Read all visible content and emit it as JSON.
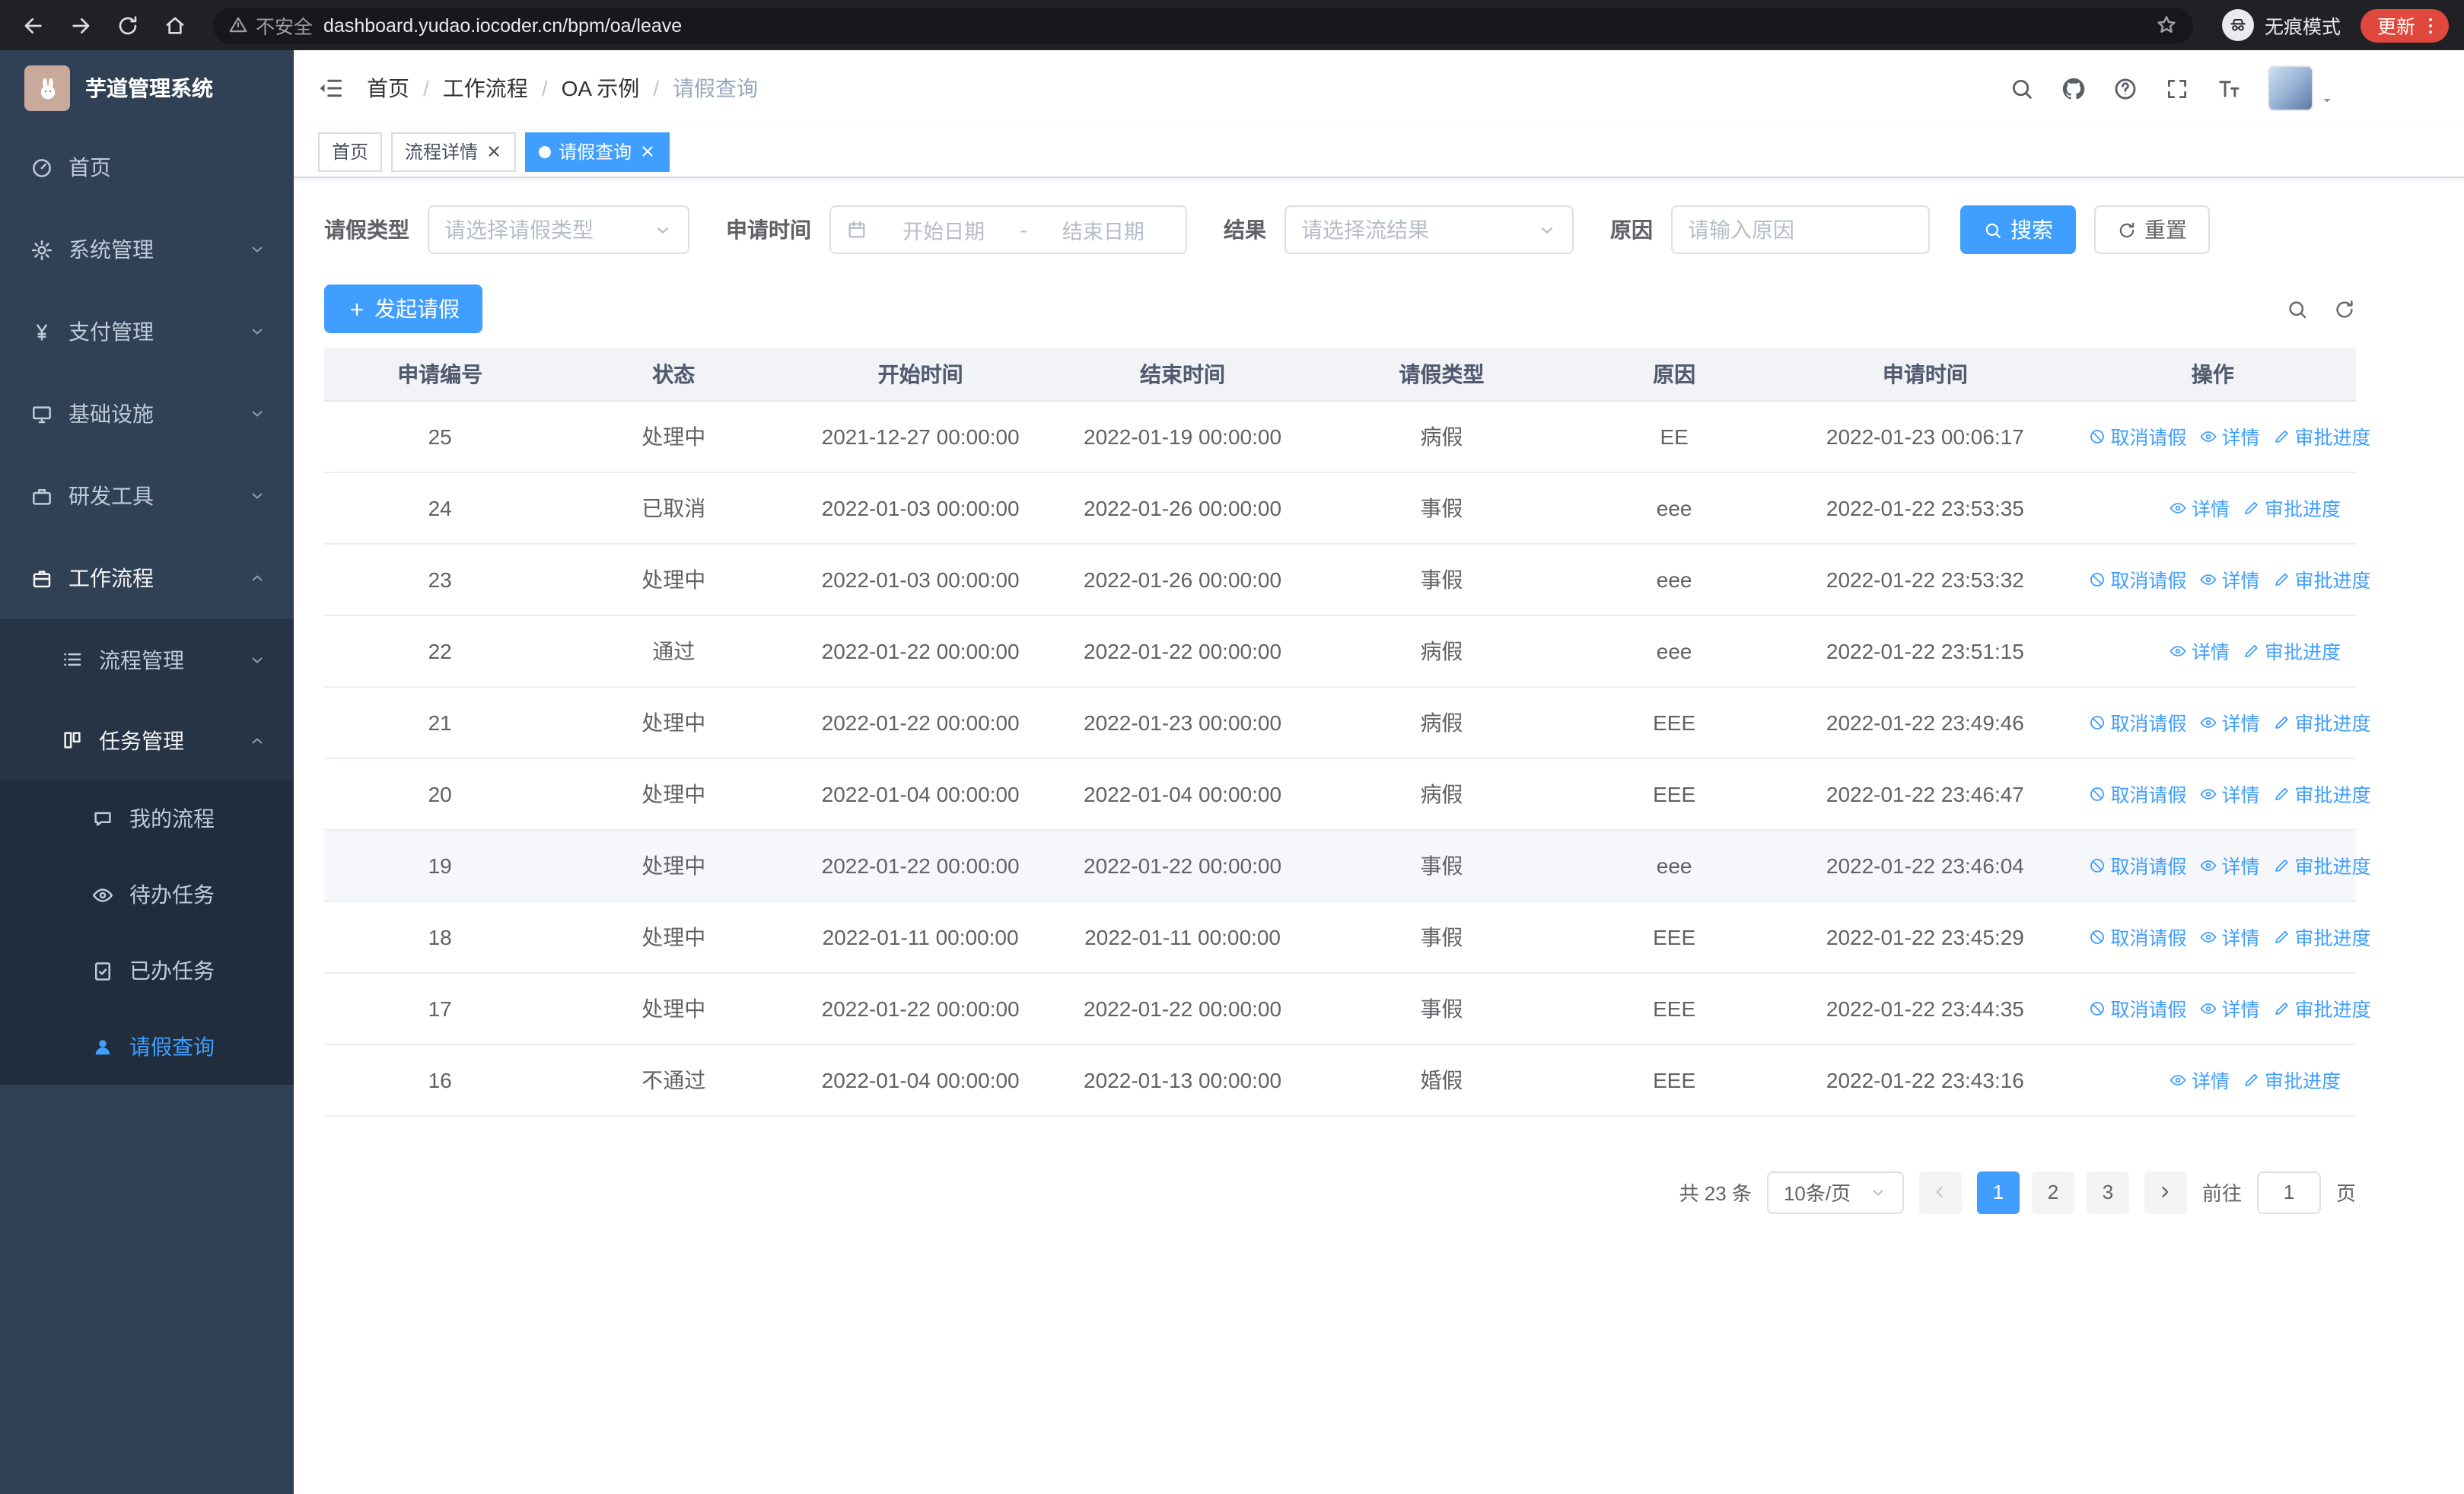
{
  "browser": {
    "nav_icons": [
      "back",
      "forward",
      "reload",
      "home"
    ],
    "security_chip": "不安全",
    "url": "dashboard.yudao.iocoder.cn/bpm/oa/leave",
    "incognito_label": "无痕模式",
    "update_button": "更新"
  },
  "colors": {
    "primary": "#409eff",
    "sidebar_bg": "#304156",
    "update_pill": "#e0483d"
  },
  "sidebar": {
    "title": "芋道管理系统",
    "menu": [
      {
        "key": "home",
        "label": "首页",
        "icon": "i-gauge",
        "level": 1
      },
      {
        "key": "system-management",
        "label": "系统管理",
        "icon": "i-gear",
        "level": 1,
        "chevron": "down"
      },
      {
        "key": "payment-management",
        "label": "支付管理",
        "icon": "i-yen",
        "level": 1,
        "chevron": "down"
      },
      {
        "key": "infrastructure",
        "label": "基础设施",
        "icon": "i-monitor",
        "level": 1,
        "chevron": "down"
      },
      {
        "key": "dev-tools",
        "label": "研发工具",
        "icon": "i-briefcase",
        "level": 1,
        "chevron": "down"
      },
      {
        "key": "workflow",
        "label": "工作流程",
        "icon": "i-case",
        "level": 1,
        "chevron": "up",
        "open": true
      },
      {
        "key": "process-management",
        "label": "流程管理",
        "icon": "i-list",
        "level": 2,
        "chevron": "down"
      },
      {
        "key": "task-management",
        "label": "任务管理",
        "icon": "i-kanban",
        "level": 2,
        "chevron": "up",
        "open": true
      },
      {
        "key": "my-processes",
        "label": "我的流程",
        "icon": "i-chat",
        "level": 3
      },
      {
        "key": "todo-tasks",
        "label": "待办任务",
        "icon": "i-eye",
        "level": 3
      },
      {
        "key": "done-tasks",
        "label": "已办任务",
        "icon": "i-doccheck",
        "level": 3
      },
      {
        "key": "leave-query",
        "label": "请假查询",
        "icon": "i-user",
        "level": 3,
        "active": true
      }
    ]
  },
  "header": {
    "breadcrumb": [
      "首页",
      "工作流程",
      "OA 示例",
      "请假查询"
    ],
    "icons": [
      "search",
      "github",
      "question",
      "fullscreen",
      "font-size"
    ]
  },
  "tabs": [
    {
      "label": "首页",
      "closable": false,
      "active": false
    },
    {
      "label": "流程详情",
      "closable": true,
      "active": false
    },
    {
      "label": "请假查询",
      "closable": true,
      "active": true
    }
  ],
  "filters": {
    "leave_type_label": "请假类型",
    "leave_type_placeholder": "请选择请假类型",
    "apply_time_label": "申请时间",
    "start_date_placeholder": "开始日期",
    "range_separator": "-",
    "end_date_placeholder": "结束日期",
    "result_label": "结果",
    "result_placeholder": "请选择流结果",
    "reason_label": "原因",
    "reason_placeholder": "请输入原因",
    "search_button": "搜索",
    "reset_button": "重置"
  },
  "toolbar": {
    "create_button": "发起请假",
    "icons": [
      "search",
      "refresh"
    ]
  },
  "table": {
    "columns": [
      "申请编号",
      "状态",
      "开始时间",
      "结束时间",
      "请假类型",
      "原因",
      "申请时间",
      "操作"
    ],
    "action_labels": {
      "cancel": "取消请假",
      "detail": "详情",
      "progress": "审批进度"
    },
    "rows": [
      {
        "id": "25",
        "status": "处理中",
        "start": "2021-12-27 00:00:00",
        "end": "2022-01-19 00:00:00",
        "type": "病假",
        "reason": "EE",
        "applied": "2022-01-23 00:06:17",
        "actions": [
          "cancel",
          "detail",
          "progress"
        ]
      },
      {
        "id": "24",
        "status": "已取消",
        "start": "2022-01-03 00:00:00",
        "end": "2022-01-26 00:00:00",
        "type": "事假",
        "reason": "eee",
        "applied": "2022-01-22 23:53:35",
        "actions": [
          "detail",
          "progress"
        ]
      },
      {
        "id": "23",
        "status": "处理中",
        "start": "2022-01-03 00:00:00",
        "end": "2022-01-26 00:00:00",
        "type": "事假",
        "reason": "eee",
        "applied": "2022-01-22 23:53:32",
        "actions": [
          "cancel",
          "detail",
          "progress"
        ]
      },
      {
        "id": "22",
        "status": "通过",
        "start": "2022-01-22 00:00:00",
        "end": "2022-01-22 00:00:00",
        "type": "病假",
        "reason": "eee",
        "applied": "2022-01-22 23:51:15",
        "actions": [
          "detail",
          "progress"
        ]
      },
      {
        "id": "21",
        "status": "处理中",
        "start": "2022-01-22 00:00:00",
        "end": "2022-01-23 00:00:00",
        "type": "病假",
        "reason": "EEE",
        "applied": "2022-01-22 23:49:46",
        "actions": [
          "cancel",
          "detail",
          "progress"
        ]
      },
      {
        "id": "20",
        "status": "处理中",
        "start": "2022-01-04 00:00:00",
        "end": "2022-01-04 00:00:00",
        "type": "病假",
        "reason": "EEE",
        "applied": "2022-01-22 23:46:47",
        "actions": [
          "cancel",
          "detail",
          "progress"
        ]
      },
      {
        "id": "19",
        "status": "处理中",
        "start": "2022-01-22 00:00:00",
        "end": "2022-01-22 00:00:00",
        "type": "事假",
        "reason": "eee",
        "applied": "2022-01-22 23:46:04",
        "actions": [
          "cancel",
          "detail",
          "progress"
        ],
        "highlight": true
      },
      {
        "id": "18",
        "status": "处理中",
        "start": "2022-01-11 00:00:00",
        "end": "2022-01-11 00:00:00",
        "type": "事假",
        "reason": "EEE",
        "applied": "2022-01-22 23:45:29",
        "actions": [
          "cancel",
          "detail",
          "progress"
        ]
      },
      {
        "id": "17",
        "status": "处理中",
        "start": "2022-01-22 00:00:00",
        "end": "2022-01-22 00:00:00",
        "type": "事假",
        "reason": "EEE",
        "applied": "2022-01-22 23:44:35",
        "actions": [
          "cancel",
          "detail",
          "progress"
        ]
      },
      {
        "id": "16",
        "status": "不通过",
        "start": "2022-01-04 00:00:00",
        "end": "2022-01-13 00:00:00",
        "type": "婚假",
        "reason": "EEE",
        "applied": "2022-01-22 23:43:16",
        "actions": [
          "detail",
          "progress"
        ]
      }
    ]
  },
  "pagination": {
    "total": "共 23 条",
    "page_size": "10条/页",
    "pages": [
      "1",
      "2",
      "3"
    ],
    "active_page": "1",
    "goto_label": "前往",
    "goto_value": "1",
    "goto_suffix": "页"
  }
}
